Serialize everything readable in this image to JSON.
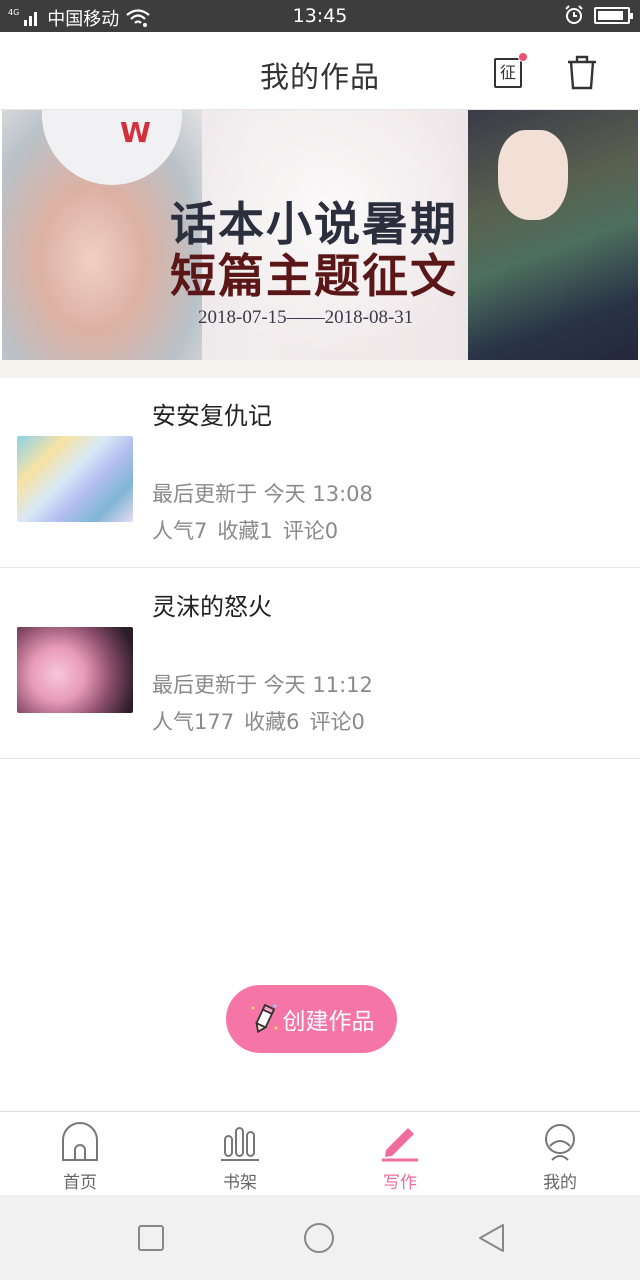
{
  "status_bar": {
    "network_tag": "4G",
    "carrier": "中国移动",
    "time": "13:45",
    "battery_level": 0.9
  },
  "header": {
    "title": "我的作品",
    "contest_icon_char": "征"
  },
  "banner": {
    "line1": "话本小说暑期",
    "line2": "短篇主题征文",
    "dates": "2018-07-15——2018-08-31",
    "cap_logo": "W"
  },
  "works": [
    {
      "name": "安安复仇记",
      "updated": "最后更新于 今天 13:08",
      "popularity": "人气7",
      "favorites": "收藏1",
      "comments": "评论0"
    },
    {
      "name": "灵沫的怒火",
      "updated": "最后更新于 今天 11:12",
      "popularity": "人气177",
      "favorites": "收藏6",
      "comments": "评论0"
    }
  ],
  "create_button": {
    "label": "创建作品"
  },
  "tabs": [
    {
      "label": "首页",
      "icon": "home-icon",
      "active": false
    },
    {
      "label": "书架",
      "icon": "bookshelf-icon",
      "active": false
    },
    {
      "label": "写作",
      "icon": "pencil-icon",
      "active": true
    },
    {
      "label": "我的",
      "icon": "profile-icon",
      "active": false
    }
  ],
  "colors": {
    "accent": "#f06c9b",
    "create_button": "#f576a6",
    "badge_dot": "#f0506e",
    "status_bar": "#3d3d3d"
  }
}
